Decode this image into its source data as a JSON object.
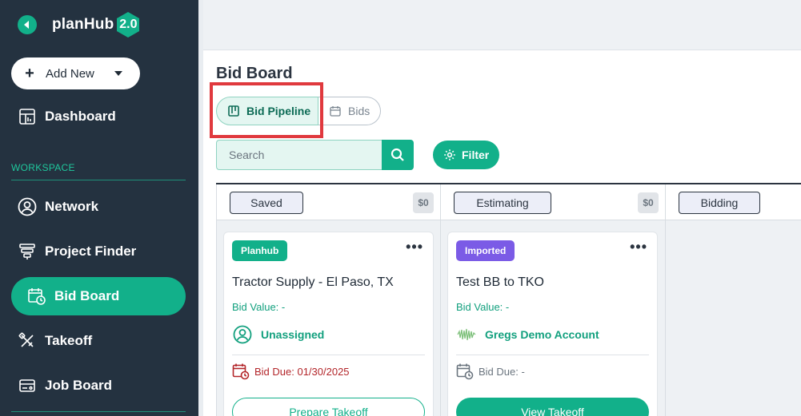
{
  "brand": {
    "name": "planHub",
    "version": "2.0",
    "accent": "#12b08a",
    "sidebar_bg": "#243240"
  },
  "sidebar": {
    "add_new_label": "Add New",
    "workspace_label": "WORKSPACE",
    "items": [
      {
        "label": "Dashboard",
        "icon": "dashboard-icon"
      },
      {
        "label": "Network",
        "icon": "user-circle-icon"
      },
      {
        "label": "Project Finder",
        "icon": "project-finder-icon"
      },
      {
        "label": "Bid Board",
        "icon": "calendar-clock-icon",
        "active": true
      },
      {
        "label": "Takeoff",
        "icon": "takeoff-tools-icon"
      },
      {
        "label": "Job Board",
        "icon": "id-card-icon"
      }
    ]
  },
  "main": {
    "title": "Bid Board",
    "tabs": [
      {
        "label": "Bid Pipeline",
        "icon": "kanban-icon",
        "active": true
      },
      {
        "label": "Bids",
        "icon": "calendar-icon",
        "active": false
      }
    ],
    "search": {
      "placeholder": "Search",
      "value": ""
    },
    "filter_label": "Filter"
  },
  "board": {
    "columns": [
      {
        "status": "Saved",
        "total": "$0"
      },
      {
        "status": "Estimating",
        "total": "$0"
      },
      {
        "status": "Bidding"
      }
    ],
    "cards": [
      {
        "badge": "Planhub",
        "title": "Tractor Supply - El Paso, TX",
        "bid_value": "Bid Value: -",
        "assignee": "Unassigned",
        "due": "Bid Due: 01/30/2025",
        "button": "Prepare Takeoff"
      },
      {
        "badge": "Imported",
        "title": "Test BB to TKO",
        "bid_value": "Bid Value: -",
        "assignee": "Gregs Demo Account",
        "due": "Bid Due: -",
        "button": "View Takeoff"
      }
    ],
    "more_label": "•••"
  }
}
